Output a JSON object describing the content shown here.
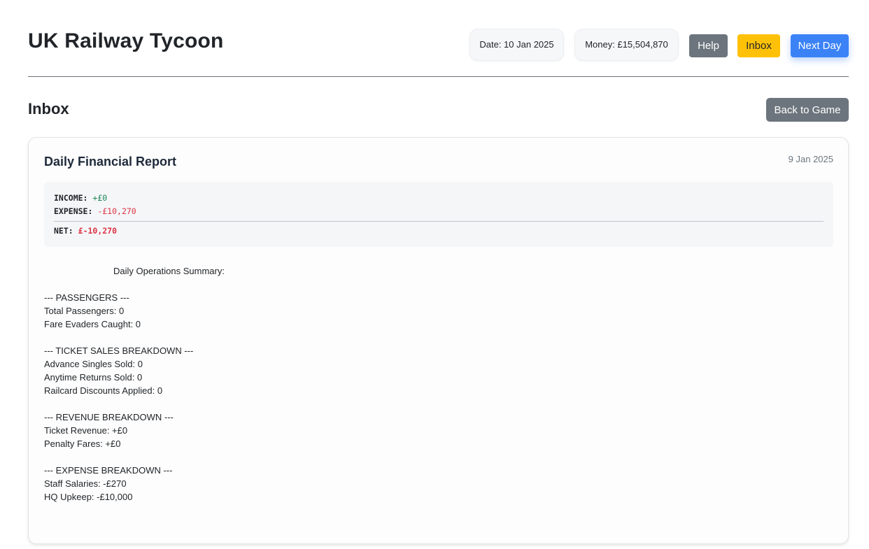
{
  "app": {
    "title": "UK Railway Tycoon"
  },
  "header": {
    "date_label": "Date: 10 Jan 2025",
    "money_label": "Money: £15,504,870",
    "help_label": "Help",
    "inbox_label": "Inbox",
    "next_day_label": "Next Day"
  },
  "section": {
    "title": "Inbox",
    "back_label": "Back to Game"
  },
  "message": {
    "title": "Daily Financial Report",
    "date": "9 Jan 2025",
    "financials": {
      "income_label": "INCOME:",
      "income_value": "+£0",
      "expense_label": "EXPENSE:",
      "expense_value": "-£10,270",
      "net_label": "NET:",
      "net_value": "£-10,270"
    },
    "summary": {
      "heading": "Daily Operations Summary:",
      "passengers_header": "--- PASSENGERS ---",
      "total_passengers": "Total Passengers: 0",
      "fare_evaders": "Fare Evaders Caught: 0",
      "ticket_sales_header": "--- TICKET SALES BREAKDOWN ---",
      "advance_singles": "Advance Singles Sold: 0",
      "anytime_returns": "Anytime Returns Sold: 0",
      "railcard_discounts": "Railcard Discounts Applied: 0",
      "revenue_header": "--- REVENUE BREAKDOWN ---",
      "ticket_revenue": "Ticket Revenue: +£0",
      "penalty_fares": "Penalty Fares: +£0",
      "expense_header": "--- EXPENSE BREAKDOWN ---",
      "staff_salaries": "Staff Salaries: -£270",
      "hq_upkeep": "HQ Upkeep: -£10,000"
    }
  },
  "colors": {
    "primary": "#3b82f6",
    "secondary": "#6c757d",
    "warning": "#ffc107",
    "positive": "#198754",
    "negative": "#dc3545"
  }
}
